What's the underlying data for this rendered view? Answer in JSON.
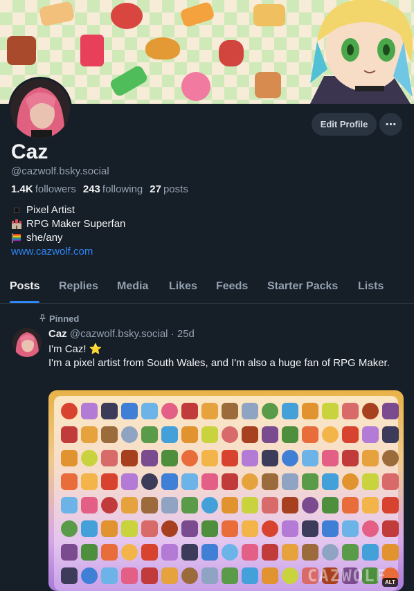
{
  "profile": {
    "name": "Caz",
    "handle": "@cazwolf.bsky.social",
    "followers_count": "1.4K",
    "followers_label": "followers",
    "following_count": "243",
    "following_label": "following",
    "posts_count": "27",
    "posts_label": "posts",
    "bio": {
      "line1": "Pixel Artist",
      "line2": "RPG Maker Superfan",
      "line3": "she/any",
      "link": "www.cazwolf.com"
    }
  },
  "actions": {
    "edit_profile": "Edit Profile",
    "more": "⋯"
  },
  "tabs": [
    "Posts",
    "Replies",
    "Media",
    "Likes",
    "Feeds",
    "Starter Packs",
    "Lists"
  ],
  "active_tab": "Posts",
  "post": {
    "pinned_label": "Pinned",
    "author_name": "Caz",
    "author_handle": "@cazwolf.bsky.social",
    "separator": "·",
    "time_ago": "25d",
    "line1": "I'm Caz!",
    "line1_emoji": "⭐",
    "line2": "I'm a pixel artist from South Wales, and I'm also a huge fan of RPG Maker.",
    "image_watermark": "CAZWOLF",
    "alt_badge": "ALT"
  },
  "icons": {
    "more": "ellipsis-icon",
    "pin": "pin-icon",
    "bio1": "black-square-icon",
    "bio2": "castle-icon",
    "bio3": "rainbow-flag-icon"
  },
  "colors": {
    "background": "#161e27",
    "accent": "#2f86f5",
    "muted_text": "#93a1b1",
    "button_bg": "#2a3441"
  }
}
